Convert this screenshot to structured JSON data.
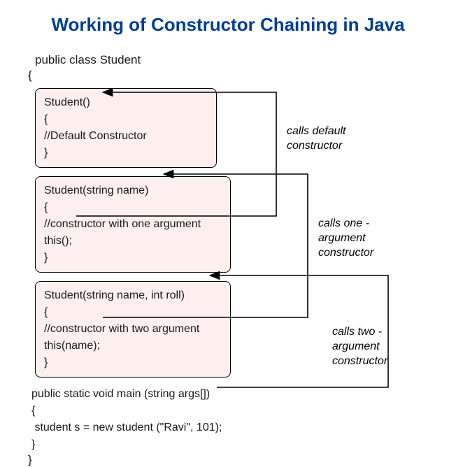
{
  "title": "Working of Constructor Chaining in Java",
  "classHeader": "public class Student",
  "openBrace": "{",
  "closeBrace": "}",
  "box1": {
    "line1": "Student()",
    "line2": "{",
    "line3": "//Default Constructor",
    "line4": "}"
  },
  "box2": {
    "line1": "Student(string name)",
    "line2": "{",
    "line3": "//constructor with one argument",
    "line4": "this();",
    "line5": "}"
  },
  "box3": {
    "line1": "Student(string name, int roll)",
    "line2": "{",
    "line3": "//constructor with two argument",
    "line4": "this(name);",
    "line5": "}"
  },
  "mainBlock": {
    "line1": "public static void main (string args[])",
    "line2": "{",
    "line3": " student s = new student (\"Ravi\", 101);",
    "line4": "}"
  },
  "annotations": {
    "a1": "calls default constructor",
    "a2": "calls one - argument constructor",
    "a3": "calls two - argument constructor"
  }
}
